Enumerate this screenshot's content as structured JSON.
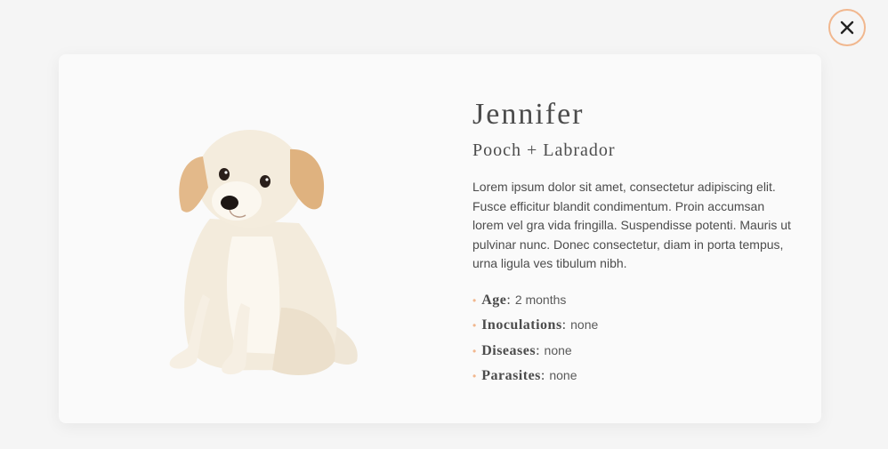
{
  "modal": {
    "pet": {
      "name": "Jennifer",
      "breed": "Pooch + Labrador",
      "description": "Lorem ipsum dolor sit amet, consectetur adipiscing elit. Fusce efficitur blandit condimentum. Proin accumsan lorem vel gra vida fringilla. Suspendisse potenti. Mauris ut pulvinar nunc. Donec consectetur, diam in porta tempus, urna ligula ves tibulum nibh.",
      "facts": [
        {
          "label": "Age",
          "value": "2 months"
        },
        {
          "label": "Inoculations",
          "value": "none"
        },
        {
          "label": "Diseases",
          "value": "none"
        },
        {
          "label": "Parasites",
          "value": "none"
        }
      ]
    },
    "photo_icon": "puppy-photo",
    "close_icon": "close-icon"
  },
  "colors": {
    "accent": "#f1b78e",
    "text": "#4c4c4c",
    "background": "#f5f5f5",
    "card": "#fafafa"
  }
}
